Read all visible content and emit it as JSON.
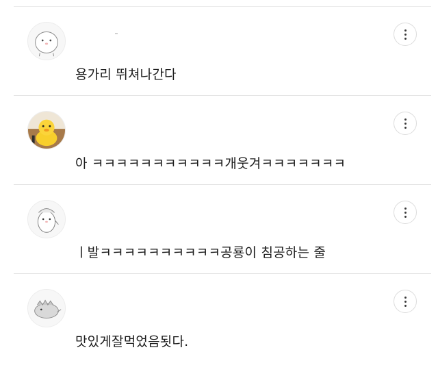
{
  "comments": [
    {
      "avatar_icon": "round-blob-character-icon",
      "text": "용가리 뛰쳐나간다"
    },
    {
      "avatar_icon": "yellow-duckling-icon",
      "text": "아 ㅋㅋㅋㅋㅋㅋㅋㅋㅋㅋㅋ개웃겨ㅋㅋㅋㅋㅋㅋㅋ"
    },
    {
      "avatar_icon": "penguin-character-icon",
      "text": "ㅣ발ㅋㅋㅋㅋㅋㅋㅋㅋㅋㅋ공룡이 침공하는 줄"
    },
    {
      "avatar_icon": "dinosaur-character-icon",
      "text": "맛있게잘먹었음됫다."
    }
  ],
  "more_icon": "vertical-dots-more-icon"
}
